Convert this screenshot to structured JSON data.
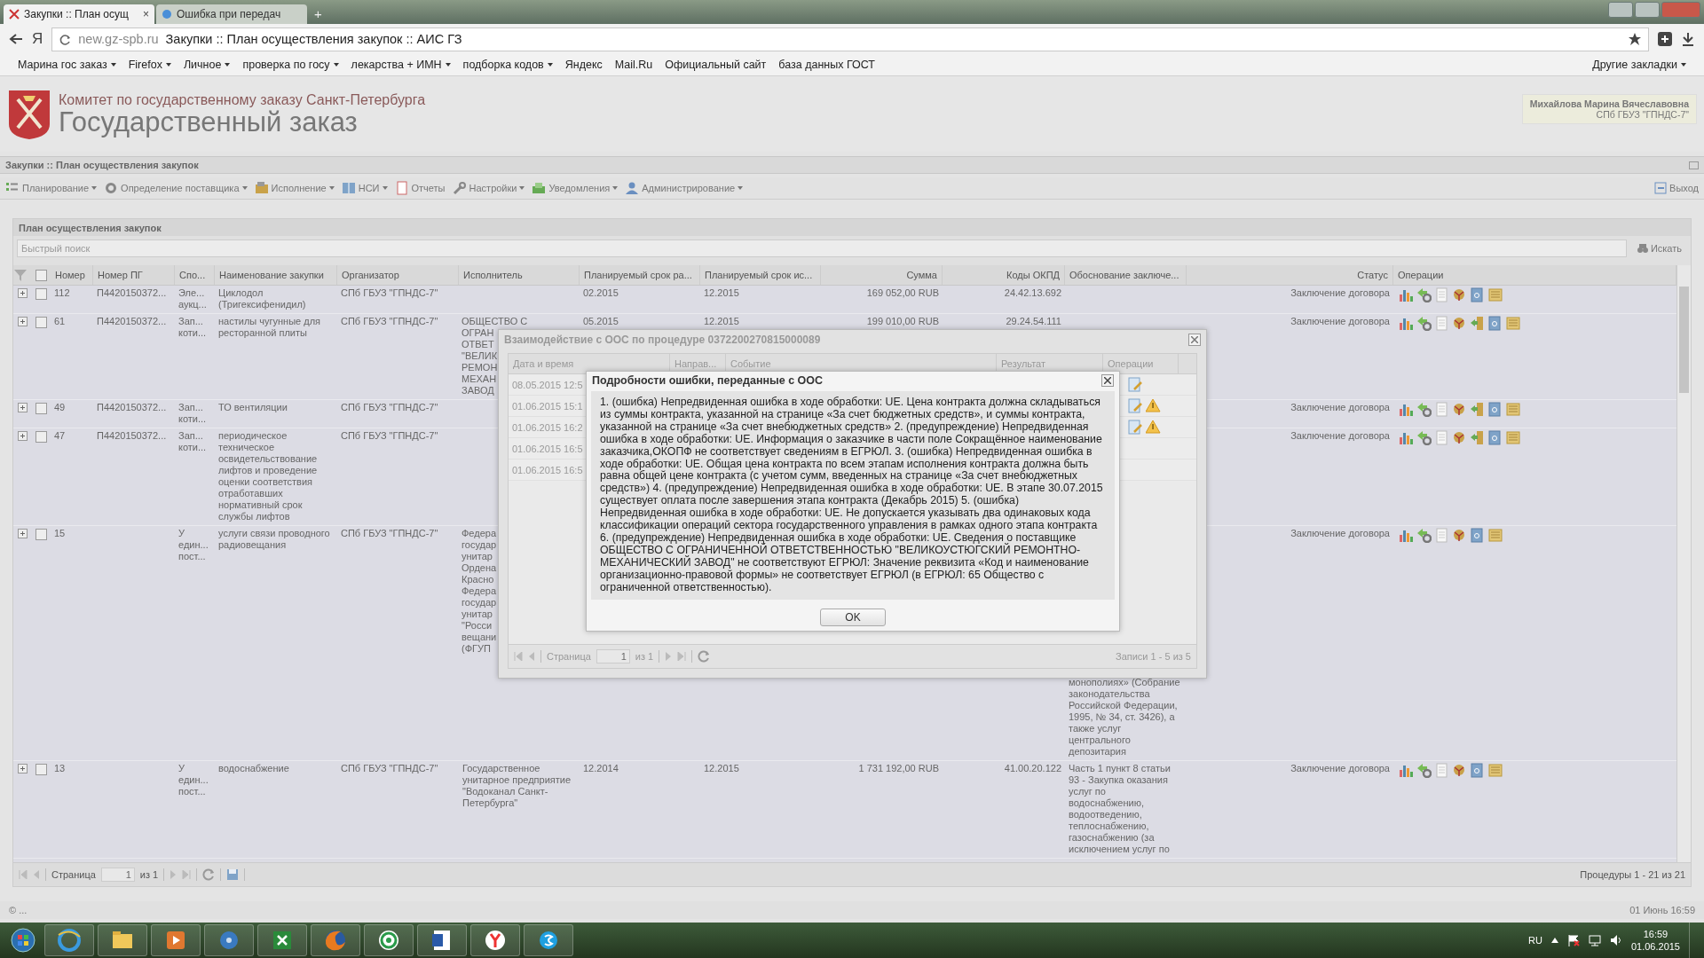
{
  "browser": {
    "tabs": [
      {
        "title": "Закупки :: План осущ",
        "selected": true
      },
      {
        "title": "Ошибка при передач",
        "selected": false
      }
    ],
    "close_tab": "×",
    "new_tab": "+",
    "home_button": "Я",
    "host": "new.gz-spb.ru",
    "page_title": "Закупки :: План осуществления закупок :: АИС ГЗ",
    "bookmarks": [
      {
        "label": "Марина гос заказ",
        "dropdown": true
      },
      {
        "label": "Firefox",
        "dropdown": true
      },
      {
        "label": "Личное",
        "dropdown": true
      },
      {
        "label": "проверка по госу",
        "dropdown": true
      },
      {
        "label": "лекарства + ИМН",
        "dropdown": true
      },
      {
        "label": "подборка кодов",
        "dropdown": true
      },
      {
        "label": "Яндекс",
        "dropdown": false
      },
      {
        "label": "Mail.Ru",
        "dropdown": false
      },
      {
        "label": "Официальный сайт",
        "dropdown": false
      },
      {
        "label": "база данных ГОСТ",
        "dropdown": false
      }
    ],
    "other_bookmarks": "Другие закладки"
  },
  "header": {
    "org": "Комитет по государственному заказу Санкт-Петербурга",
    "title": "Государственный заказ",
    "user": "Михайлова Марина Вячеславовна",
    "user_org": "СПб ГБУЗ \"ГПНДС-7\""
  },
  "panel_title": "Закупки :: План осуществления закупок",
  "menu": [
    {
      "label": "Планирование",
      "dropdown": true
    },
    {
      "label": "Определение поставщика",
      "dropdown": true
    },
    {
      "label": "Исполнение",
      "dropdown": true
    },
    {
      "label": "НСИ",
      "dropdown": true
    },
    {
      "label": "Отчеты",
      "dropdown": false
    },
    {
      "label": "Настройки",
      "dropdown": true
    },
    {
      "label": "Уведомления",
      "dropdown": true
    },
    {
      "label": "Администрирование",
      "dropdown": true
    }
  ],
  "logout": "Выход",
  "plan": {
    "title": "План осуществления закупок",
    "select_all_checked": false,
    "search_placeholder": "Быстрый поиск",
    "search_button": "Искать",
    "columns": [
      "Номер",
      "Номер ПГ",
      "Спо...",
      "Наименование закупки",
      "Организатор",
      "Исполнитель",
      "Планируемый срок ра...",
      "Планируемый срок ис...",
      "Сумма",
      "Коды ОКПД",
      "Обоснование заключе...",
      "Статус",
      "Операции"
    ],
    "rows": [
      {
        "checked": false,
        "expanded": false,
        "kind": "basic",
        "number": "112",
        "pg": "П4420150372...",
        "method": [
          "Эле...",
          "аукц..."
        ],
        "name": "Циклодол (Тригексифенидил)",
        "organizer": "СПб ГБУЗ \"ГПНДС-7\"",
        "start": "02.2015",
        "end": "12.2015",
        "sum": "169 052,00 RUB",
        "okpd": "24.42.13.692",
        "status": "Заключение договора"
      },
      {
        "checked": false,
        "expanded": false,
        "kind": "transfer",
        "number": "61",
        "pg": "П4420150372...",
        "method": [
          "Зап...",
          "коти..."
        ],
        "name": "настилы чугунные для ресторанной плиты",
        "organizer": "СПб ГБУЗ \"ГПНДС-7\"",
        "executor": [
          "ОБЩЕСТВО С",
          "ОГРАН",
          "ОТВЕТ",
          "\"ВЕЛИК",
          "РЕМОН",
          "МЕХАН",
          "ЗАВОД"
        ],
        "executor_covered": true,
        "start": "05.2015",
        "end": "12.2015",
        "sum": "199 010,00 RUB",
        "okpd": "29.24.54.111",
        "status": "Заключение договора"
      },
      {
        "checked": false,
        "expanded": false,
        "kind": "transfer",
        "number": "49",
        "pg": "П4420150372...",
        "method": [
          "Зап...",
          "коти..."
        ],
        "name": "ТО вентиляции",
        "organizer": "СПб ГБУЗ \"ГПНДС-7\"",
        "status": "Заключение договора"
      },
      {
        "checked": false,
        "expanded": false,
        "kind": "transfer",
        "number": "47",
        "pg": "П4420150372...",
        "method": [
          "Зап...",
          "коти..."
        ],
        "name": "периодическое техническое освидетельствование лифтов и проведение оценки соответствия отработавших нормативный срок службы лифтов",
        "organizer": "СПб ГБУЗ \"ГПНДС-7\"",
        "status": "Заключение договора"
      },
      {
        "checked": false,
        "expanded": false,
        "kind": "basic",
        "number": "15",
        "method": [
          "У",
          "един...",
          "пост..."
        ],
        "name": "услуги связи проводного радиовещания",
        "organizer": "СПб ГБУЗ \"ГПНДС-7\"",
        "executor": [
          "Федера",
          "государ",
          "унитар",
          "Ордена",
          "Красно",
          "Федера",
          "государ",
          "унитар",
          "\"Росси",
          "вещани",
          "(ФГУП"
        ],
        "executor_covered": true,
        "reason": [
          "монополиях» (Собрание",
          "законодательства",
          "Российской Федерации,",
          "1995, № 34, ст. 3426), а",
          "также услуг",
          "центрального",
          "депозитария"
        ],
        "reason_covered": true,
        "status": "Заключение договора"
      },
      {
        "checked": false,
        "expanded": false,
        "kind": "basic",
        "number": "13",
        "method": [
          "У",
          "един...",
          "пост..."
        ],
        "name": "водоснабжение",
        "organizer": "СПб ГБУЗ \"ГПНДС-7\"",
        "executor": [
          "Государственное",
          "унитарное предприятие",
          "\"Водоканал Санкт-",
          "Петербурга\""
        ],
        "executor_covered": false,
        "start": "12.2014",
        "end": "12.2015",
        "sum": "1 731 192,00 RUB",
        "okpd": "41.00.20.122",
        "reason": [
          "Часть 1 пункт 8 статьи",
          "93 - Закупка оказания",
          "услуг по",
          "водоснабжению,",
          "водоотведению,",
          "теплоснабжению,",
          "газоснабжению (за",
          "исключением услуг по"
        ],
        "reason_covered": false,
        "status": "Заключение договора"
      }
    ],
    "pager": {
      "label": "Страница",
      "page": "1",
      "of": "из 1"
    },
    "summary": "Процедуры 1 - 21 из 21"
  },
  "status_bar": {
    "left": "© ...",
    "right": "01 Июнь 16:59"
  },
  "interaction_dialog": {
    "title": "Взаимодействие с ООС по процедуре 0372200270815000089",
    "columns": [
      "Дата и время",
      "Направ...",
      "Событие",
      "Результат",
      "Операции"
    ],
    "rows": [
      {
        "time": "08.05.2015 12:5",
        "kind": "doc"
      },
      {
        "time": "01.06.2015 15:1",
        "kind": "warning"
      },
      {
        "time": "01.06.2015 16:2",
        "kind": "warning"
      },
      {
        "time": "01.06.2015 16:5",
        "kind": "plain"
      },
      {
        "time": "01.06.2015 16:5",
        "kind": "plain"
      }
    ],
    "pager": {
      "label": "Страница",
      "page": "1",
      "of": "из 1"
    },
    "summary": "Записи 1 - 5 из 5"
  },
  "error_dialog": {
    "title": "Подробности ошибки, переданные с ООС",
    "text": "1. (ошибка) Непредвиденная ошибка в ходе обработки: UE. Цена контракта должна складываться из суммы контракта, указанной на странице «За счет бюджетных средств», и суммы контракта, указанной на странице «За счет внебюджетных средств» 2. (предупреждение) Непредвиденная ошибка в ходе обработки: UE. Информация о заказчике в части поле Сокращённое наименование заказчика,ОКОПФ не соответствует сведениям в ЕГРЮЛ. 3. (ошибка) Непредвиденная ошибка в ходе обработки: UE. Общая цена контракта по всем этапам исполнения контракта должна быть равна общей цене контракта (с учетом сумм, введенных на странице «За счет внебюджетных средств») 4. (предупреждение) Непредвиденная ошибка в ходе обработки: UE. В этапе 30.07.2015 существует оплата после завершения этапа контракта (Декабрь 2015) 5. (ошибка) Непредвиденная ошибка в ходе обработки: UE. Не допускается указывать два одинаковых кода классификации операций сектора государственного управления в рамках одного этапа контракта 6. (предупреждение) Непредвиденная ошибка в ходе обработки: UE. Сведения о поставщике ОБЩЕСТВО С ОГРАНИЧЕННОЙ ОТВЕТСТВЕННОСТЬЮ \"ВЕЛИКОУСТЮГСКИЙ РЕМОНТНО-МЕХАНИЧЕСКИЙ ЗАВОД\" не соответствуют ЕГРЮЛ: Значение реквизита «Код и наименование организационно-правовой формы» не соответствует ЕГРЮЛ (в ЕГРЮЛ: 65 Общество с ограниченной ответственностью).",
    "ok": "OK"
  },
  "taskbar": {
    "language": "RU",
    "time": "16:59",
    "date": "01.06.2015"
  }
}
